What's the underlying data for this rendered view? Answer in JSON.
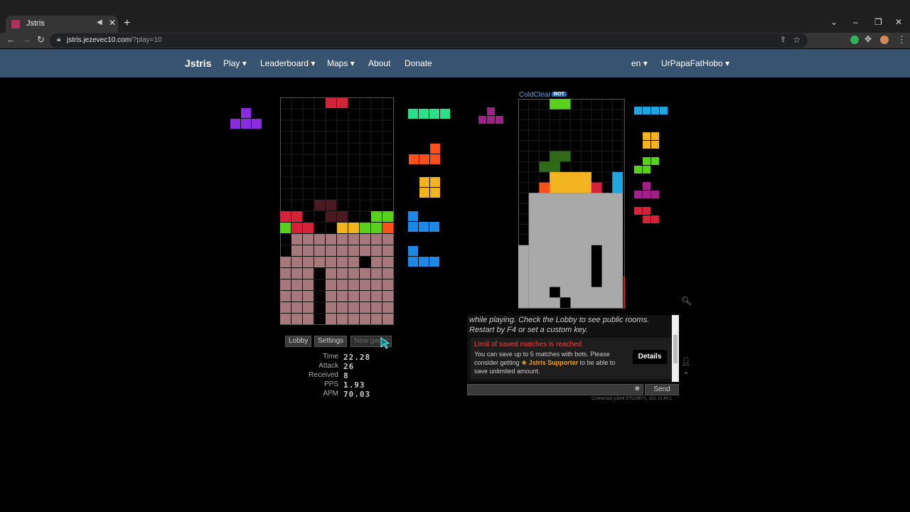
{
  "browser": {
    "tab_title": "Jstris",
    "url_host": "jstris.jezevec10.com",
    "url_path": "/?play=10"
  },
  "nav": {
    "brand": "Jstris",
    "play": "Play",
    "leaderboard": "Leaderboard",
    "maps": "Maps",
    "about": "About",
    "donate": "Donate",
    "lang": "en",
    "user": "UrPapaFatHobo"
  },
  "game": {
    "buttons": {
      "lobby": "Lobby",
      "settings": "Settings",
      "new_game": "New game"
    },
    "stats": [
      {
        "label": "Time",
        "value": "22.28"
      },
      {
        "label": "Attack",
        "value": "26"
      },
      {
        "label": "Received",
        "value": "8"
      },
      {
        "label": "PPS",
        "value": "1.93"
      },
      {
        "label": "APM",
        "value": "70.03"
      }
    ],
    "player_hold": "T",
    "player_queue": [
      "I",
      "L",
      "O",
      "J",
      "J"
    ],
    "bot": {
      "name": "ColdClear",
      "tag": "BOT",
      "hold": "T",
      "queue": [
        "I",
        "O",
        "S",
        "T",
        "Z"
      ]
    }
  },
  "colors": {
    "I": "#2ce08a",
    "I_bot": "#1da6e0",
    "T": "#8a2be2",
    "T_bot": "#a0208a",
    "L": "#ff4f1a",
    "O": "#f2b520",
    "J": "#1e88e5",
    "S": "#58d11e",
    "Z": "#d3223a",
    "garbage": "#a5787b",
    "bot_garbage": "#a9a9a9"
  },
  "chat": {
    "message": "while playing. Check the Lobby to see public rooms. Restart by F4 or set a custom key.",
    "alert_title": "Limit of saved matches is reached",
    "alert_body_1": "You can save up to 5 matches with bots. Please consider getting",
    "alert_supporter": "★ Jstris Supporter",
    "alert_body_2": "to be able to save unlimited amount.",
    "details": "Details",
    "input_placeholder": "",
    "send": "Send",
    "status": "Connected (client 97023907), s52, v1.40.1"
  }
}
